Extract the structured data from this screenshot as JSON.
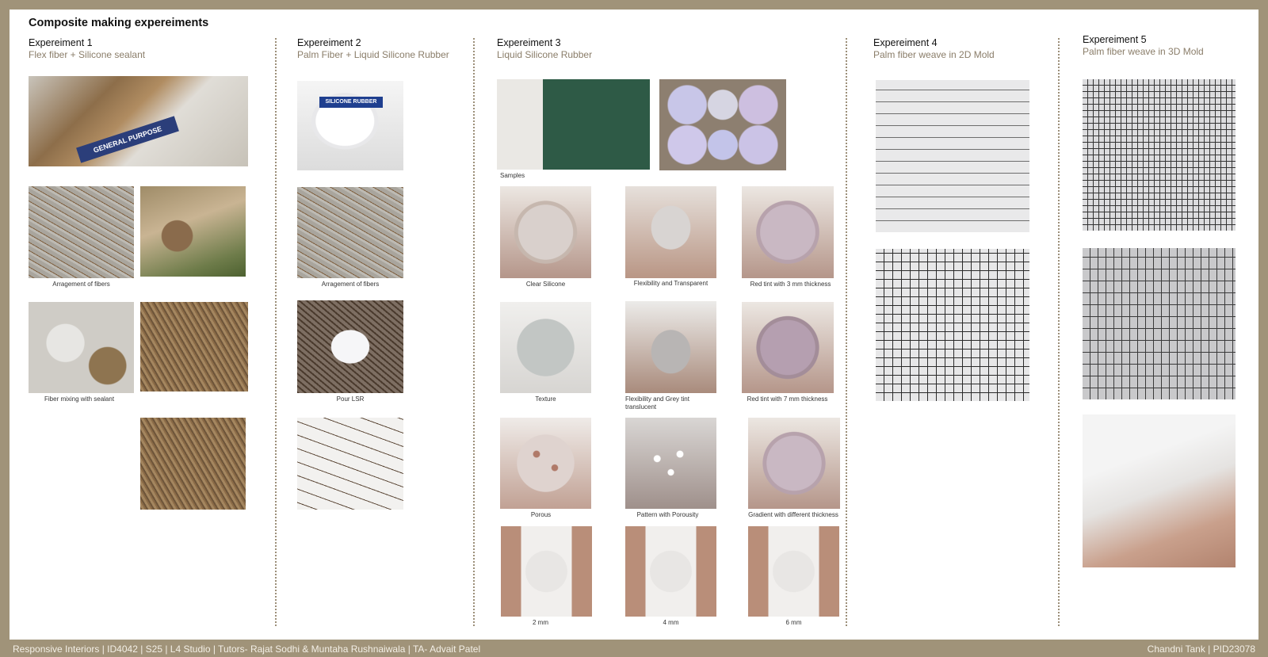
{
  "page_title": "Composite making expereiments",
  "experiments": [
    {
      "heading": "Expereiment 1",
      "subheading": "Flex fiber + Silicone sealant",
      "captions": {
        "arrangement": "Arragement of fibers",
        "mixing": "Fiber mixing with sealant"
      }
    },
    {
      "heading": "Expereiment 2",
      "subheading": "Palm Fiber + Liquid Silicone Rubber",
      "captions": {
        "arrangement": "Arragement of fibers",
        "pour": "Pour LSR"
      }
    },
    {
      "heading": "Expereiment 3",
      "subheading": "Liquid Silicone Rubber",
      "captions": {
        "samples": "Samples",
        "clear": "Clear Silicone",
        "flex_transparent": "Flexibility and Transparent",
        "red3": "Red tint with 3 mm thickness",
        "texture": "Texture",
        "flex_grey": "Flexibility and  Grey tint translucent",
        "red7": "Red tint with 7 mm thickness",
        "porous": "Porous",
        "pattern": "Pattern with Porousity",
        "gradient": "Gradient with different thickness",
        "t2": "2 mm",
        "t4": "4 mm",
        "t6": "6 mm"
      }
    },
    {
      "heading": "Expereiment 4",
      "subheading": "Palm fiber weave in 2D Mold"
    },
    {
      "heading": "Expereiment 5",
      "subheading": "Palm fiber weave in 3D Mold"
    }
  ],
  "photo_labels": {
    "tube": "GENERAL PURPOSE",
    "bucket": "SILICONE RUBBER"
  },
  "footer": {
    "left": "Responsive Interiors | ID4042 | S25 | L4 Studio | Tutors- Rajat Sodhi & Muntaha Rushnaiwala | TA- Advait Patel",
    "right": "Chandni Tank | PID23078"
  },
  "colors": {
    "frame": "#a09379",
    "subheading": "#8a7d69",
    "divider": "#9c8f79"
  }
}
